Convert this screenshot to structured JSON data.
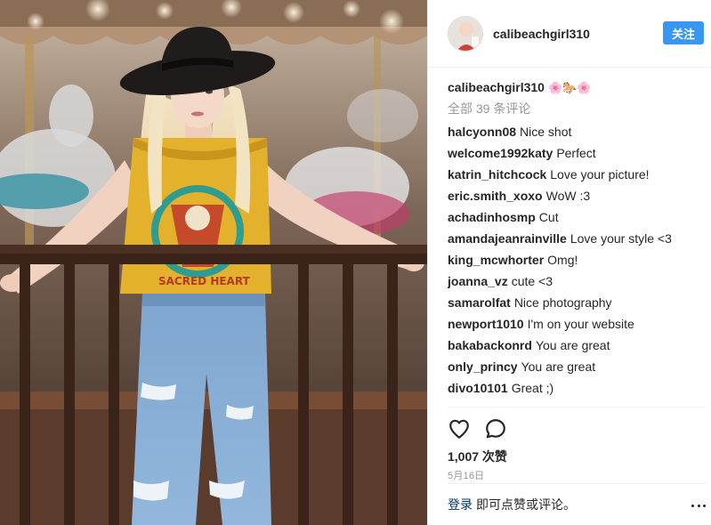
{
  "post": {
    "photo_icon": "photo-of-woman-in-hat-at-carousel"
  },
  "header": {
    "username": "calibeachgirl310",
    "follow_label": "关注",
    "avatar_icon": "profile-photo-icon"
  },
  "caption": {
    "username": "calibeachgirl310",
    "emoji": "🌸🐎🌸"
  },
  "all_comments_label": "全部 39 条评论",
  "comments": [
    {
      "user": "halcyonn08",
      "text": "Nice shot"
    },
    {
      "user": "welcome1992katy",
      "text": "Perfect"
    },
    {
      "user": "katrin_hitchcock",
      "text": "Love your picture!"
    },
    {
      "user": "eric.smith_xoxo",
      "text": "WoW :3"
    },
    {
      "user": "achadinhosmp",
      "text": "Cut"
    },
    {
      "user": "amandajeanrainville",
      "text": "Love your style <3"
    },
    {
      "user": "king_mcwhorter",
      "text": "Omg!"
    },
    {
      "user": "joanna_vz",
      "text": "cute <3"
    },
    {
      "user": "samarolfat",
      "text": "Nice photography"
    },
    {
      "user": "newport1010",
      "text": "I'm on your website"
    },
    {
      "user": "bakabackonrd",
      "text": "You are great"
    },
    {
      "user": "only_princy",
      "text": "You are great"
    },
    {
      "user": "divo10101",
      "text": "Great ;)"
    }
  ],
  "actions": {
    "like_icon": "heart-icon",
    "comment_icon": "comment-bubble-icon",
    "likes_label": "1,007 次赞",
    "date": "5月16日"
  },
  "footer": {
    "login_label": "登录",
    "login_rest": "即可点赞或评论。",
    "more_icon": "more-options-icon"
  },
  "colors": {
    "accent": "#3897f0",
    "link": "#003569",
    "muted": "#999999",
    "text": "#262626"
  }
}
